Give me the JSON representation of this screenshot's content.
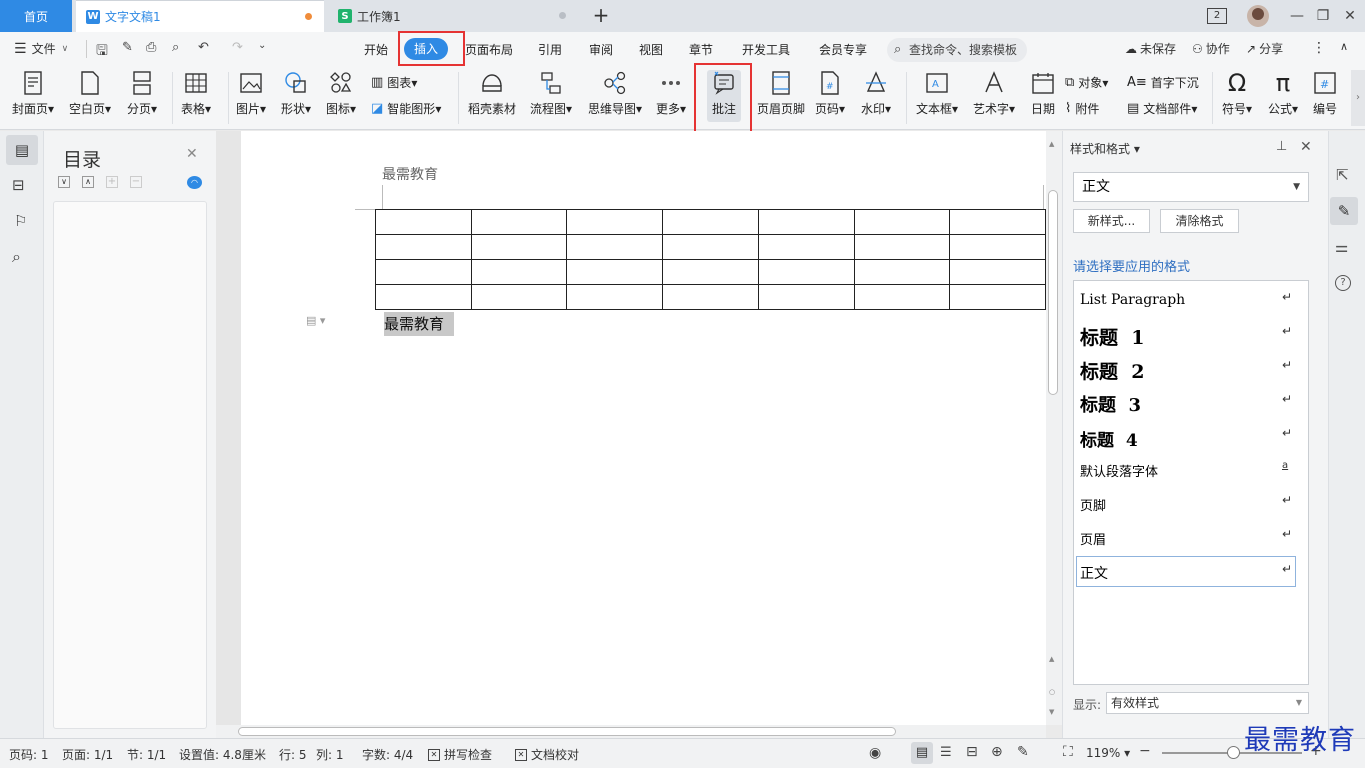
{
  "tabs": {
    "home": "首页",
    "doc": "文字文稿1",
    "sheet": "工作簿1",
    "doc_icon": "W",
    "sheet_icon": "S",
    "add": "+",
    "tab_count": "2"
  },
  "menu": {
    "file": "文件",
    "items": [
      "开始",
      "插入",
      "页面布局",
      "引用",
      "审阅",
      "视图",
      "章节",
      "开发工具",
      "会员专享"
    ],
    "search": "查找命令、搜索模板",
    "unsaved": "未保存",
    "collab": "协作",
    "share": "分享"
  },
  "ribbon": {
    "cover": "封面页",
    "blank": "空白页",
    "pagebreak": "分页",
    "table": "表格",
    "picture": "图片",
    "shape": "形状",
    "icon": "图标",
    "chart": "图表",
    "smartart": "智能图形",
    "material": "稻壳素材",
    "flowchart": "流程图",
    "mindmap": "思维导图",
    "more": "更多",
    "comment": "批注",
    "headerfooter": "页眉页脚",
    "pagenum": "页码",
    "watermark": "水印",
    "textbox": "文本框",
    "wordart": "艺术字",
    "date": "日期",
    "object": "对象",
    "dropcap": "首字下沉",
    "attachment": "附件",
    "docpart": "文档部件",
    "symbol": "符号",
    "formula": "公式",
    "numbering": "编号"
  },
  "toc": {
    "title": "目录"
  },
  "document": {
    "header_text": "最需教育",
    "body_text": "最需教育",
    "table_rows": 4,
    "table_cols": 7
  },
  "style_panel": {
    "title": "样式和格式",
    "current": "正文",
    "new_style": "新样式...",
    "clear": "清除格式",
    "prompt": "请选择要应用的格式",
    "styles": [
      "List Paragraph",
      "标题  1",
      "标题  2",
      "标题  3",
      "标题  4",
      "默认段落字体",
      "页脚",
      "页眉",
      "正文"
    ],
    "show_label": "显示:",
    "show_value": "有效样式"
  },
  "status": {
    "page_num": "页码: 1",
    "pages": "页面: 1/1",
    "section": "节: 1/1",
    "setting": "设置值: 4.8厘米",
    "row": "行: 5",
    "col": "列: 1",
    "words": "字数: 4/4",
    "spell": "拼写检查",
    "proof": "文档校对",
    "zoom": "119%"
  },
  "watermark": "最需教育",
  "colors": {
    "accent": "#2f8ae4",
    "highlight": "#e53333",
    "wps_green": "#20b36d"
  }
}
